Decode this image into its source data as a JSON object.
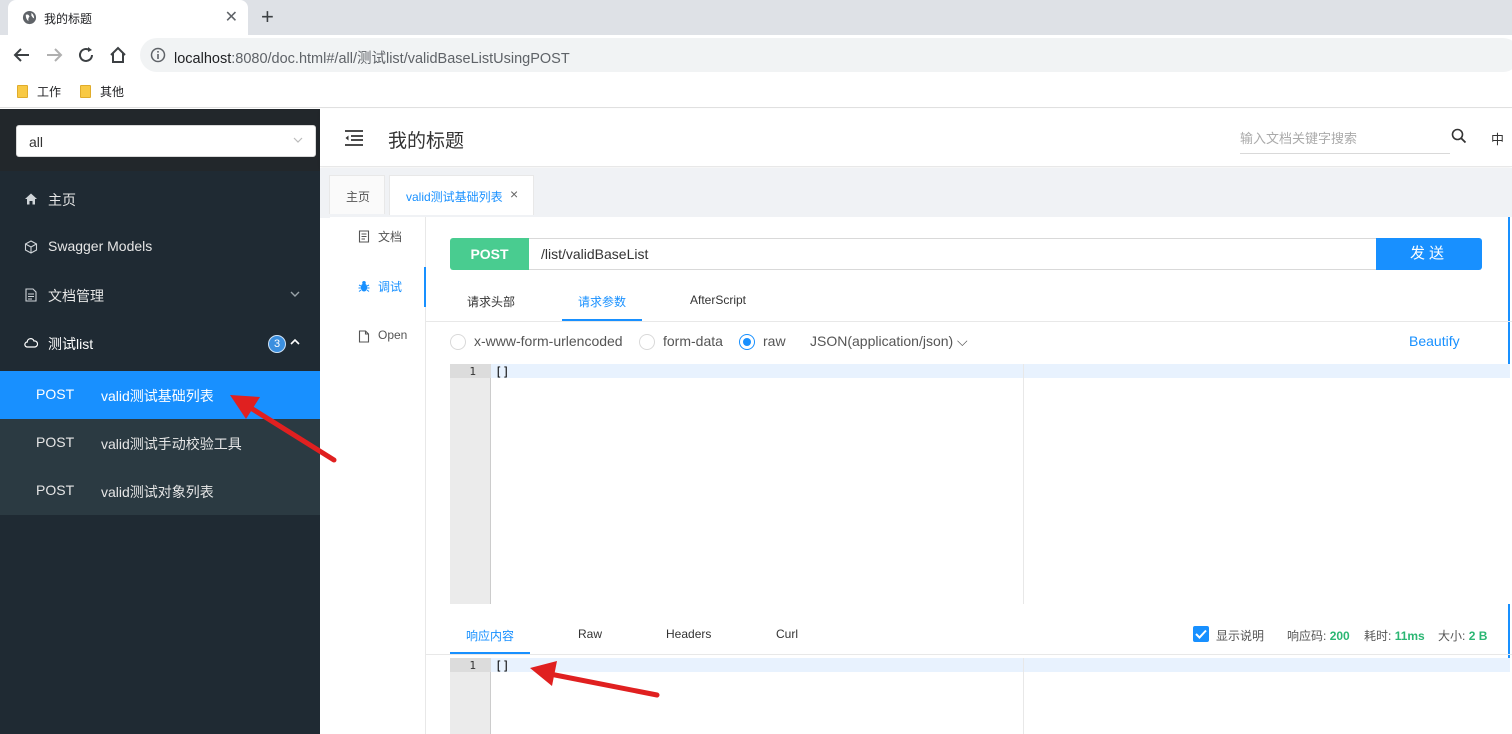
{
  "browser": {
    "tab_title": "我的标题",
    "url_host": "localhost",
    "url_rest": ":8080/doc.html#/all/测试list/validBaseListUsingPOST",
    "bookmarks": [
      "工作",
      "其他"
    ]
  },
  "sidebar": {
    "group_select": "all",
    "items": [
      {
        "label": "主页",
        "icon": "home-icon"
      },
      {
        "label": "Swagger Models",
        "icon": "cube-icon"
      },
      {
        "label": "文档管理",
        "icon": "doc-icon"
      },
      {
        "label": "测试list",
        "icon": "cloud-icon",
        "badge": "3"
      }
    ],
    "apis": [
      {
        "method": "POST",
        "title": "valid测试基础列表",
        "active": true
      },
      {
        "method": "POST",
        "title": "valid测试手动校验工具",
        "active": false
      },
      {
        "method": "POST",
        "title": "valid测试对象列表",
        "active": false
      }
    ]
  },
  "header": {
    "title": "我的标题",
    "search_placeholder": "输入文档关键字搜索",
    "lang": "中"
  },
  "page_tabs": [
    {
      "label": "主页"
    },
    {
      "label": "valid测试基础列表",
      "closable": true
    }
  ],
  "mode_tabs": [
    {
      "label": "文档"
    },
    {
      "label": "调试"
    },
    {
      "label": "Open"
    }
  ],
  "request": {
    "method": "POST",
    "path": "/list/validBaseList",
    "send_label": "发送",
    "tabs": [
      "请求头部",
      "请求参数",
      "AfterScript"
    ],
    "body_types": [
      "x-www-form-urlencoded",
      "form-data",
      "raw"
    ],
    "content_type": "JSON(application/json)",
    "beautify": "Beautify",
    "editor_line": "1",
    "editor_code": "[]"
  },
  "response": {
    "tabs": [
      "响应内容",
      "Raw",
      "Headers",
      "Curl"
    ],
    "show_desc": "显示说明",
    "code_label": "响应码:",
    "code_value": "200",
    "time_label": "耗时:",
    "time_value": "11ms",
    "size_label": "大小:",
    "size_value": "2 B",
    "editor_line": "1",
    "editor_code": "[]"
  },
  "colors": {
    "accent": "#1890ff",
    "post": "#49cc90",
    "sidebar_bg": "#1f2a33",
    "annotation_arrow": "#e02020"
  }
}
